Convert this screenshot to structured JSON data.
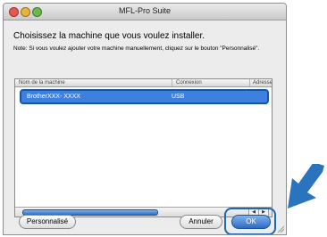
{
  "window": {
    "title": "MFL-Pro Suite"
  },
  "content": {
    "heading": "Choisissez la machine que vous voulez installer.",
    "note": "Note: Si vous voulez ajouter votre machine manuellement, cliquez sur le bouton \"Personnalisé\"."
  },
  "table": {
    "columns": [
      "Nom de la machine",
      "Connexion",
      "Adresse IP"
    ],
    "rows": [
      {
        "machine": "BrotherXXX- XXXX",
        "connection": "USB"
      }
    ]
  },
  "buttons": {
    "custom": "Personnalisé",
    "cancel": "Annuler",
    "ok": "OK"
  },
  "colors": {
    "selection": "#3d80df",
    "highlight_ring": "#1f67b0",
    "arrow": "#2a73bd"
  }
}
